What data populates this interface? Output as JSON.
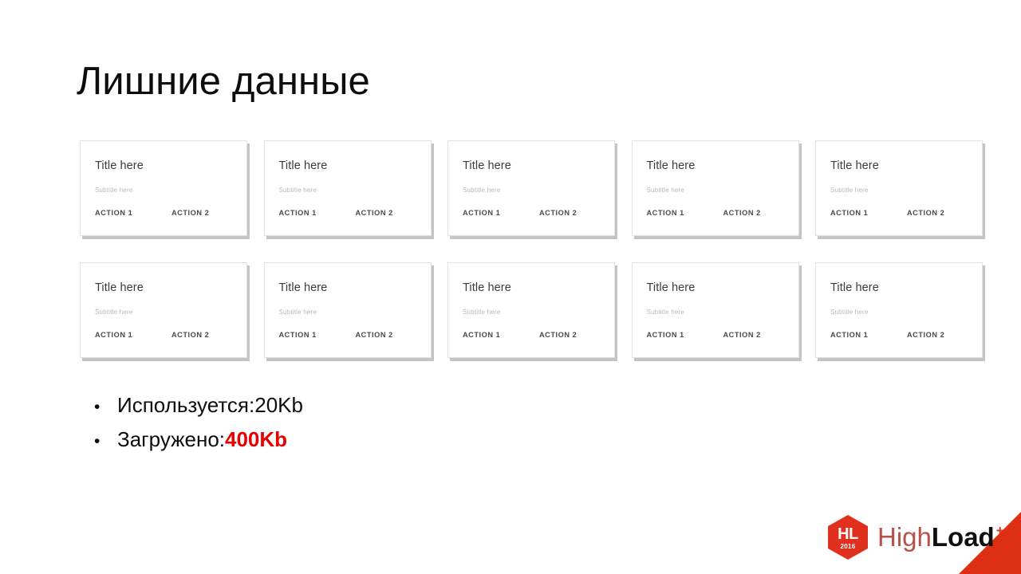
{
  "slide": {
    "title": "Лишние данные",
    "background_color": "#ffffff"
  },
  "cards": {
    "rows": 2,
    "columns": 5,
    "total": 10,
    "template": {
      "title": "Title here",
      "subtitle": "Subtitle here",
      "action_1": "ACTION 1",
      "action_2": "ACTION 2"
    },
    "items": [
      {
        "title": "Title here",
        "subtitle": "Subtitle here",
        "action_1": "ACTION 1",
        "action_2": "ACTION 2"
      },
      {
        "title": "Title here",
        "subtitle": "Subtitle here",
        "action_1": "ACTION 1",
        "action_2": "ACTION 2"
      },
      {
        "title": "Title here",
        "subtitle": "Subtitle here",
        "action_1": "ACTION 1",
        "action_2": "ACTION 2"
      },
      {
        "title": "Title here",
        "subtitle": "Subtitle here",
        "action_1": "ACTION 1",
        "action_2": "ACTION 2"
      },
      {
        "title": "Title here",
        "subtitle": "Subtitle here",
        "action_1": "ACTION 1",
        "action_2": "ACTION 2"
      },
      {
        "title": "Title here",
        "subtitle": "Subtitle here",
        "action_1": "ACTION 1",
        "action_2": "ACTION 2"
      },
      {
        "title": "Title here",
        "subtitle": "Subtitle here",
        "action_1": "ACTION 1",
        "action_2": "ACTION 2"
      },
      {
        "title": "Title here",
        "subtitle": "Subtitle here",
        "action_1": "ACTION 1",
        "action_2": "ACTION 2"
      },
      {
        "title": "Title here",
        "subtitle": "Subtitle here",
        "action_1": "ACTION 1",
        "action_2": "ACTION 2"
      },
      {
        "title": "Title here",
        "subtitle": "Subtitle here",
        "action_1": "ACTION 1",
        "action_2": "ACTION 2"
      }
    ]
  },
  "bullets": {
    "marker": "•",
    "items": [
      {
        "label": "Используется: ",
        "value": "20Kb",
        "highlight": false
      },
      {
        "label": "Загружено: ",
        "value": "400Kb",
        "highlight": true
      }
    ],
    "highlight_color": "#e60000"
  },
  "logo": {
    "badge_initials": "HL",
    "badge_year": "2016",
    "word_first": "High",
    "word_second": "Load",
    "word_suffix": "++",
    "badge_color": "#e0301e",
    "word_first_color": "#b5524a",
    "word_second_color": "#101010",
    "corner_color": "#dd3012"
  }
}
